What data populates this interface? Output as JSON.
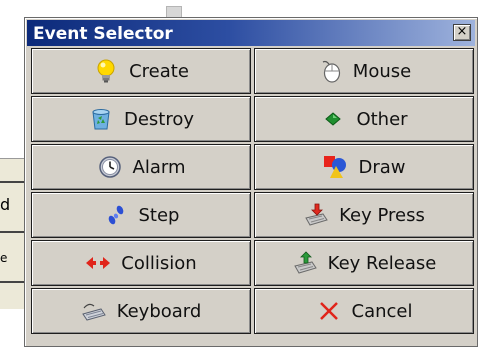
{
  "dialog": {
    "title": "Event Selector",
    "close_label": "×"
  },
  "background": {
    "text_lines": [
      "d",
      "",
      "e"
    ]
  },
  "events": [
    {
      "label": "Create",
      "icon": "lightbulb-icon"
    },
    {
      "label": "Mouse",
      "icon": "mouse-icon"
    },
    {
      "label": "Destroy",
      "icon": "recycle-bin-icon"
    },
    {
      "label": "Other",
      "icon": "green-diamond-icon"
    },
    {
      "label": "Alarm",
      "icon": "clock-icon"
    },
    {
      "label": "Draw",
      "icon": "shapes-icon"
    },
    {
      "label": "Step",
      "icon": "footsteps-icon"
    },
    {
      "label": "Key Press",
      "icon": "keyboard-press-icon"
    },
    {
      "label": "Collision",
      "icon": "collision-arrows-icon"
    },
    {
      "label": "Key Release",
      "icon": "keyboard-release-icon"
    },
    {
      "label": "Keyboard",
      "icon": "keyboard-icon"
    },
    {
      "label": "Cancel",
      "icon": "red-x-icon"
    }
  ],
  "colors": {
    "title_gradient_start": "#0c2a7a",
    "title_gradient_end": "#9fb3dd",
    "button_face": "#d4d0c8"
  }
}
